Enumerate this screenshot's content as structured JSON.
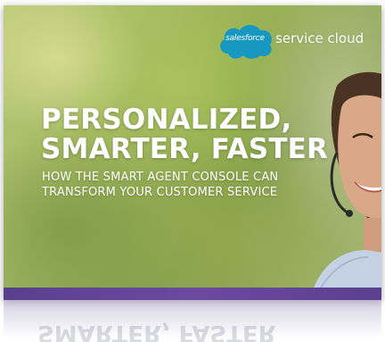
{
  "logo": {
    "brand": "salesforce",
    "product": "service cloud",
    "brand_color": "#1798c1"
  },
  "headline": {
    "line1": "PERSONALIZED,",
    "line2": "SMARTER, FASTER"
  },
  "subhead": {
    "line1": "HOW THE SMART AGENT CONSOLE CAN",
    "line2": "TRANSFORM YOUR CUSTOMER SERVICE"
  },
  "reflection": {
    "text": "SMARTER, FASTER"
  },
  "colors": {
    "band": "#5a3f8e",
    "background": "#9bb255"
  }
}
